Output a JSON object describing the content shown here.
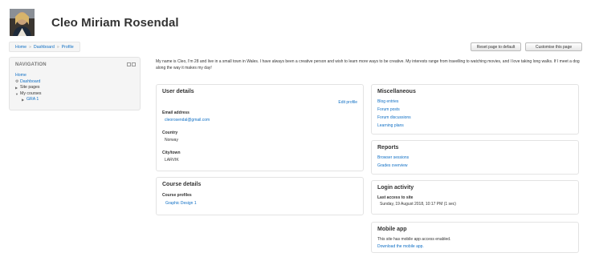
{
  "header": {
    "page_title": "Cleo Miriam Rosendal"
  },
  "breadcrumb": {
    "items": [
      "Home",
      "Dashboard",
      "Profile"
    ],
    "separator": "»"
  },
  "toolbar": {
    "reset_label": "Reset page to default",
    "customise_label": "Customise this page"
  },
  "navigation": {
    "title": "NAVIGATION",
    "items": [
      "Home",
      "Dashboard",
      "Site pages",
      "My courses",
      "GRA 1"
    ]
  },
  "profile": {
    "description": "My name is Cleo, I'm 28 and live in a small town in Wales. I have always been a creative person and wish to learn more ways to be creative. My interests range from travelling to watching movies, and I love taking long walks. If I meet a dog along the way it makes my day!"
  },
  "user_details": {
    "title": "User details",
    "edit_label": "Edit profile",
    "email_label": "Email address",
    "email_value": "cleorosendal@gmail.com",
    "country_label": "Country",
    "country_value": "Norway",
    "city_label": "City/town",
    "city_value": "LARVIK"
  },
  "course_details": {
    "title": "Course details",
    "profiles_label": "Course profiles",
    "course_link": "Graphic Design 1"
  },
  "miscellaneous": {
    "title": "Miscellaneous",
    "links": [
      "Blog entries",
      "Forum posts",
      "Forum discussions",
      "Learning plans"
    ]
  },
  "reports": {
    "title": "Reports",
    "links": [
      "Browser sessions",
      "Grades overview"
    ]
  },
  "login_activity": {
    "title": "Login activity",
    "last_access_label": "Last access to site",
    "last_access_value": "Sunday, 19 August 2018, 10:17 PM  (1 sec)"
  },
  "mobile_app": {
    "title": "Mobile app",
    "text": "This site has mobile app access enabled.",
    "download_link": "Download the mobile app."
  },
  "colors": {
    "link": "#0f6fc5",
    "border": "#e3e3e3",
    "nav_bg": "#f5f5f5"
  }
}
